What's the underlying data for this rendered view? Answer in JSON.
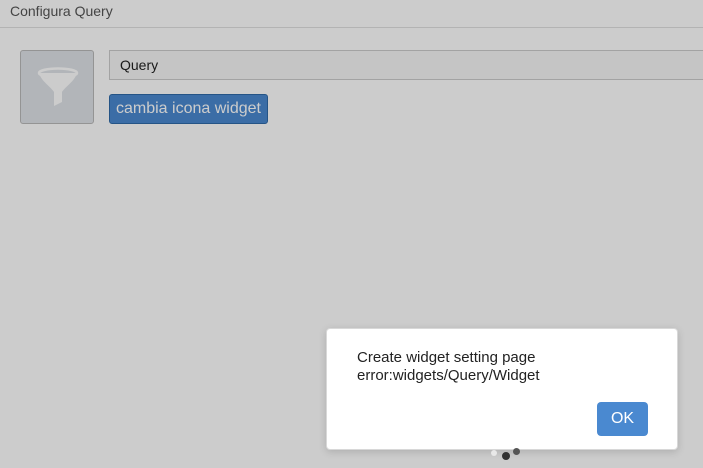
{
  "window": {
    "title": "Configura Query"
  },
  "widget": {
    "icon": "filter-funnel-icon",
    "name_value": "Query",
    "change_icon_label": "cambia icona widget"
  },
  "dialog": {
    "line1": "Create widget setting page",
    "line2": "error:widgets/Query/Widget",
    "ok_label": "OK"
  },
  "loading": {
    "icon": "loading-spinner-icon"
  },
  "colors": {
    "accent": "#4a89d0",
    "overlay": "rgba(0,0,0,0.2)"
  }
}
